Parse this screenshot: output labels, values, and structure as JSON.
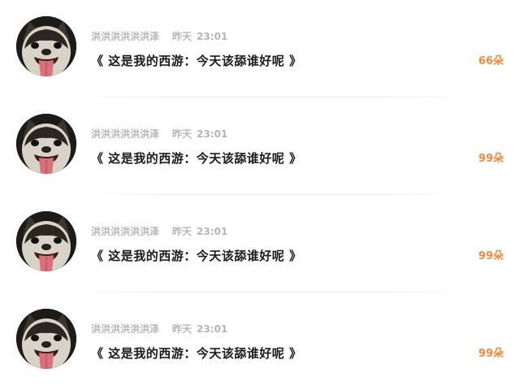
{
  "colors": {
    "name_gray": "#b5b5b5",
    "title_dark": "#1a1a1a",
    "count_orange": "#f08a3c"
  },
  "items": [
    {
      "avatar_icon": "dog-tongue-avatar",
      "username": "洪洪洪洪洪洪泽",
      "time_label": "昨天",
      "time": "23:01",
      "title": "《 这是我的西游：今天该舔谁好呢 》",
      "count": "66朵"
    },
    {
      "avatar_icon": "dog-tongue-avatar",
      "username": "洪洪洪洪洪洪泽",
      "time_label": "昨天",
      "time": "23:01",
      "title": "《 这是我的西游：今天该舔谁好呢 》",
      "count": "99朵"
    },
    {
      "avatar_icon": "dog-tongue-avatar",
      "username": "洪洪洪洪洪洪泽",
      "time_label": "昨天",
      "time": "23:01",
      "title": "《 这是我的西游：今天该舔谁好呢 》",
      "count": "99朵"
    },
    {
      "avatar_icon": "dog-tongue-avatar",
      "username": "洪洪洪洪洪洪泽",
      "time_label": "昨天",
      "time": "23:01",
      "title": "《 这是我的西游：今天该舔谁好呢 》",
      "count": "99朵"
    }
  ]
}
